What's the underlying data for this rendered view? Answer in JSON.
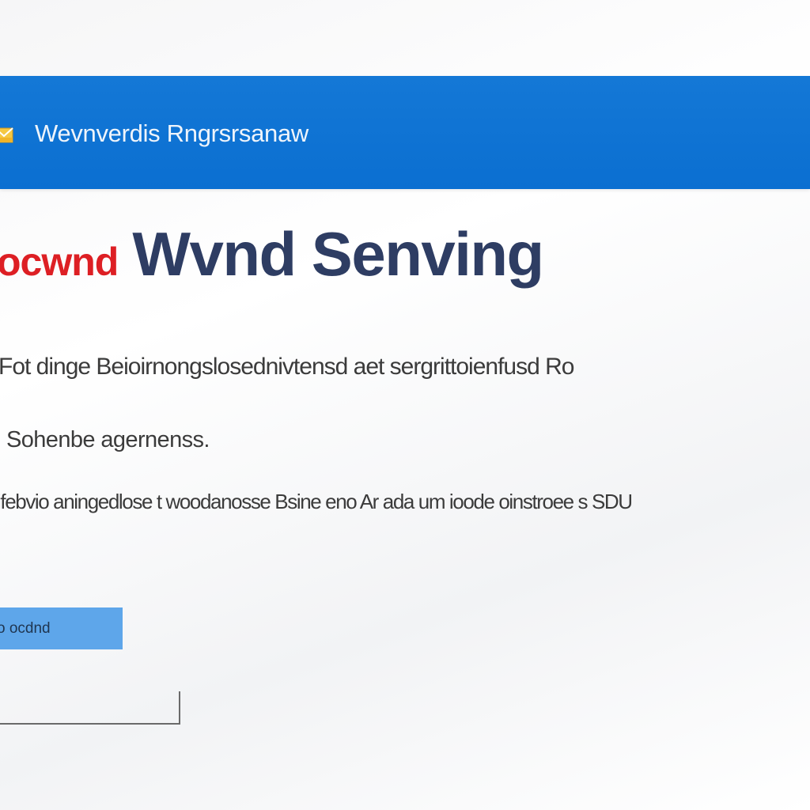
{
  "header": {
    "title": "Wevnverdis Rngrsrsanaw",
    "icon": "envelope-icon",
    "background_color": "#0b6fd1"
  },
  "headline": {
    "brand": "ocwnd",
    "brand_color": "#dd1f24",
    "main": "Wvnd Senving",
    "main_color": "#2e3d63"
  },
  "body": {
    "line_1": "Fot dinge Beioirnongslosednivtensd aet sergrittoienfusd Ro",
    "line_2": "Sohenbe agernenss.",
    "line_3": "ifebvio aningedlose t woodanosse Bsine eno Ar ada um ioode oinstroee s SDU"
  },
  "button": {
    "label": "o ocdnd",
    "color": "#5ea6ea"
  },
  "input": {
    "value": "",
    "placeholder": ""
  }
}
